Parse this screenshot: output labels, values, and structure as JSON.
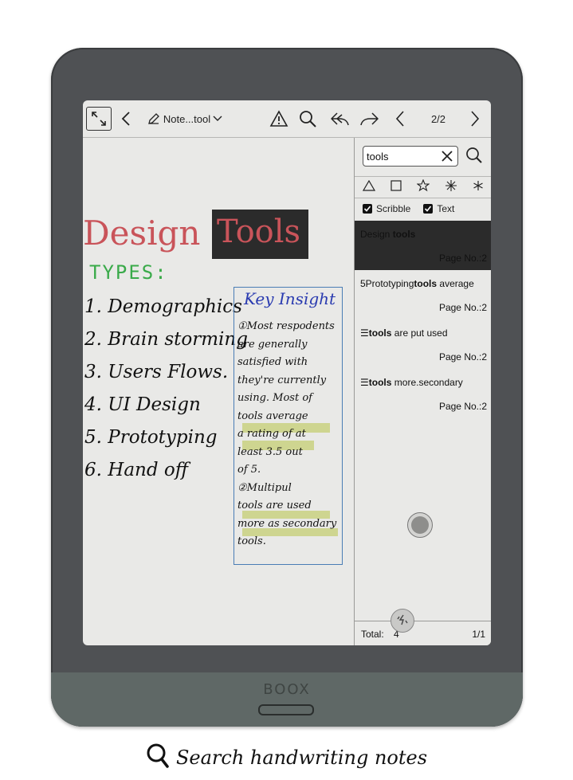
{
  "toolbar": {
    "title": "Note...tool",
    "page_indicator": "2/2"
  },
  "search": {
    "query": "tools",
    "filter_scribble": "Scribble",
    "filter_text": "Text"
  },
  "results": [
    {
      "pre": "Design ",
      "hit": "tools",
      "post": "",
      "page": "Page No.:2"
    },
    {
      "pre": "5Prototyping",
      "hit": "tools",
      "post": " average",
      "page": "Page No.:2"
    },
    {
      "pre": "☰",
      "hit": "tools",
      "post": " are put used",
      "page": "Page No.:2"
    },
    {
      "pre": "☰",
      "hit": "tools",
      "post": " more.secondary",
      "page": "Page No.:2"
    }
  ],
  "footer": {
    "total_label": "Total:",
    "total_value": "4",
    "pages": "1/1"
  },
  "note": {
    "title_design": "Design",
    "title_tools": "Tools",
    "types_label": "TYPES:",
    "list": [
      "1. Demographics",
      "2. Brain storming",
      "3. Users Flows.",
      "4. UI Design",
      "5. Prototyping",
      "6. Hand off"
    ],
    "insight_title": "Key Insight",
    "insight_lines": [
      "①Most respodents",
      "are generally",
      "satisfied with",
      "they're currently",
      "using. Most of",
      "tools average",
      "a rating of at",
      "least 3.5 out",
      "of 5.",
      "②Multipul",
      "tools are used",
      "more as secondary",
      "tools."
    ]
  },
  "device": {
    "brand": "BOOX"
  },
  "caption": "Search handwriting notes",
  "colors": {
    "design_red": "#c9545a",
    "types_green": "#3aaa4a",
    "insight_blue": "#2a3bb0",
    "highlight": "#c7cf7a"
  }
}
